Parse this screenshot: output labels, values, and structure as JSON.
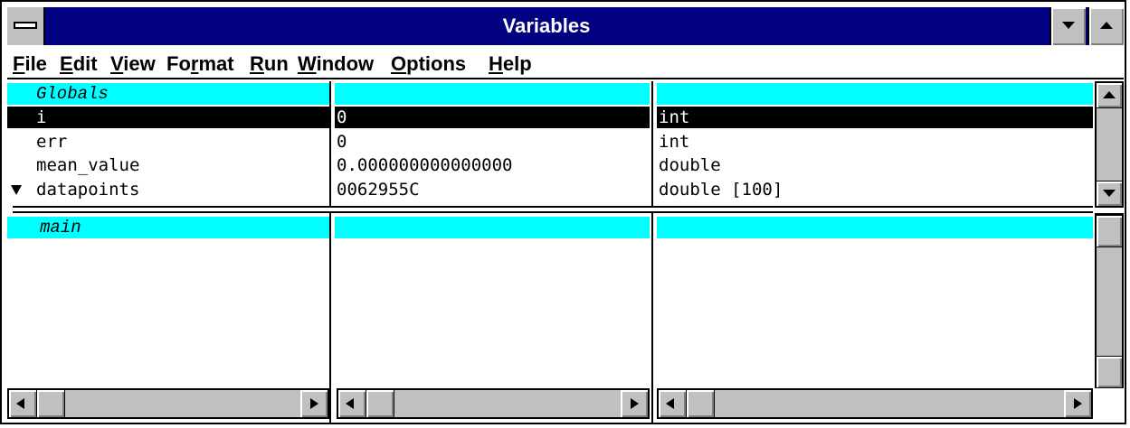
{
  "window": {
    "title": "Variables",
    "sysmenu_icon": "system-menu-icon",
    "minimize_icon": "minimize-icon",
    "maximize_icon": "maximize-icon"
  },
  "menu": {
    "items": [
      {
        "hotkey": "F",
        "rest": "ile"
      },
      {
        "hotkey": "E",
        "rest": "dit"
      },
      {
        "hotkey": "V",
        "rest": "iew"
      },
      {
        "pre": "Fo",
        "hotkey": "r",
        "rest": "mat"
      },
      {
        "hotkey": "R",
        "rest": "un"
      },
      {
        "hotkey": "W",
        "rest": "indow"
      },
      {
        "hotkey": "O",
        "rest": "ptions"
      },
      {
        "hotkey": "H",
        "rest": "elp"
      }
    ]
  },
  "globals": {
    "label": "Globals",
    "rows": [
      {
        "name": "i",
        "value": "0",
        "type": "int",
        "selected": true,
        "expandable": false
      },
      {
        "name": "err",
        "value": "0",
        "type": "int",
        "selected": false,
        "expandable": false
      },
      {
        "name": "mean_value",
        "value": "0.000000000000000",
        "type": "double",
        "selected": false,
        "expandable": false
      },
      {
        "name": "datapoints",
        "value": "0062955C",
        "type": "double [100]",
        "selected": false,
        "expandable": true
      }
    ]
  },
  "locals": {
    "label": "main"
  },
  "colors": {
    "titlebar": "#000080",
    "section_highlight": "#00ffff",
    "selection": "#000000",
    "chrome": "#c0c0c0"
  }
}
